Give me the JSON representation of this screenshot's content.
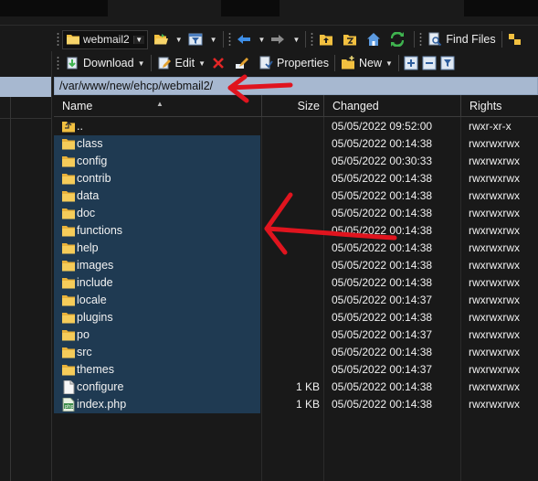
{
  "toolbar1": {
    "combo_label": "webmail2",
    "find_files_label": "Find Files"
  },
  "toolbar2": {
    "download_label": "Download",
    "edit_label": "Edit",
    "properties_label": "Properties",
    "new_label": "New"
  },
  "address": {
    "path": "/var/www/new/ehcp/webmail2/"
  },
  "columns": {
    "name": "Name",
    "size": "Size",
    "changed": "Changed",
    "rights": "Rights"
  },
  "files": [
    {
      "name": "..",
      "size": "",
      "changed": "05/05/2022 09:52:00",
      "rights": "rwxr-xr-x",
      "type": "parent"
    },
    {
      "name": "class",
      "size": "",
      "changed": "05/05/2022 00:14:38",
      "rights": "rwxrwxrwx",
      "type": "folder"
    },
    {
      "name": "config",
      "size": "",
      "changed": "05/05/2022 00:30:33",
      "rights": "rwxrwxrwx",
      "type": "folder"
    },
    {
      "name": "contrib",
      "size": "",
      "changed": "05/05/2022 00:14:38",
      "rights": "rwxrwxrwx",
      "type": "folder"
    },
    {
      "name": "data",
      "size": "",
      "changed": "05/05/2022 00:14:38",
      "rights": "rwxrwxrwx",
      "type": "folder"
    },
    {
      "name": "doc",
      "size": "",
      "changed": "05/05/2022 00:14:38",
      "rights": "rwxrwxrwx",
      "type": "folder"
    },
    {
      "name": "functions",
      "size": "",
      "changed": "05/05/2022 00:14:38",
      "rights": "rwxrwxrwx",
      "type": "folder"
    },
    {
      "name": "help",
      "size": "",
      "changed": "05/05/2022 00:14:38",
      "rights": "rwxrwxrwx",
      "type": "folder"
    },
    {
      "name": "images",
      "size": "",
      "changed": "05/05/2022 00:14:38",
      "rights": "rwxrwxrwx",
      "type": "folder"
    },
    {
      "name": "include",
      "size": "",
      "changed": "05/05/2022 00:14:38",
      "rights": "rwxrwxrwx",
      "type": "folder"
    },
    {
      "name": "locale",
      "size": "",
      "changed": "05/05/2022 00:14:37",
      "rights": "rwxrwxrwx",
      "type": "folder"
    },
    {
      "name": "plugins",
      "size": "",
      "changed": "05/05/2022 00:14:38",
      "rights": "rwxrwxrwx",
      "type": "folder"
    },
    {
      "name": "po",
      "size": "",
      "changed": "05/05/2022 00:14:37",
      "rights": "rwxrwxrwx",
      "type": "folder"
    },
    {
      "name": "src",
      "size": "",
      "changed": "05/05/2022 00:14:38",
      "rights": "rwxrwxrwx",
      "type": "folder"
    },
    {
      "name": "themes",
      "size": "",
      "changed": "05/05/2022 00:14:37",
      "rights": "rwxrwxrwx",
      "type": "folder"
    },
    {
      "name": "configure",
      "size": "1 KB",
      "changed": "05/05/2022 00:14:38",
      "rights": "rwxrwxrwx",
      "type": "file"
    },
    {
      "name": "index.php",
      "size": "1 KB",
      "changed": "05/05/2022 00:14:38",
      "rights": "rwxrwxrwx",
      "type": "php"
    }
  ],
  "colors": {
    "address_bg": "#a7b8d0",
    "selection_bg": "#1f3a52",
    "folder": "#f2c040",
    "annotation": "#e0141e"
  }
}
